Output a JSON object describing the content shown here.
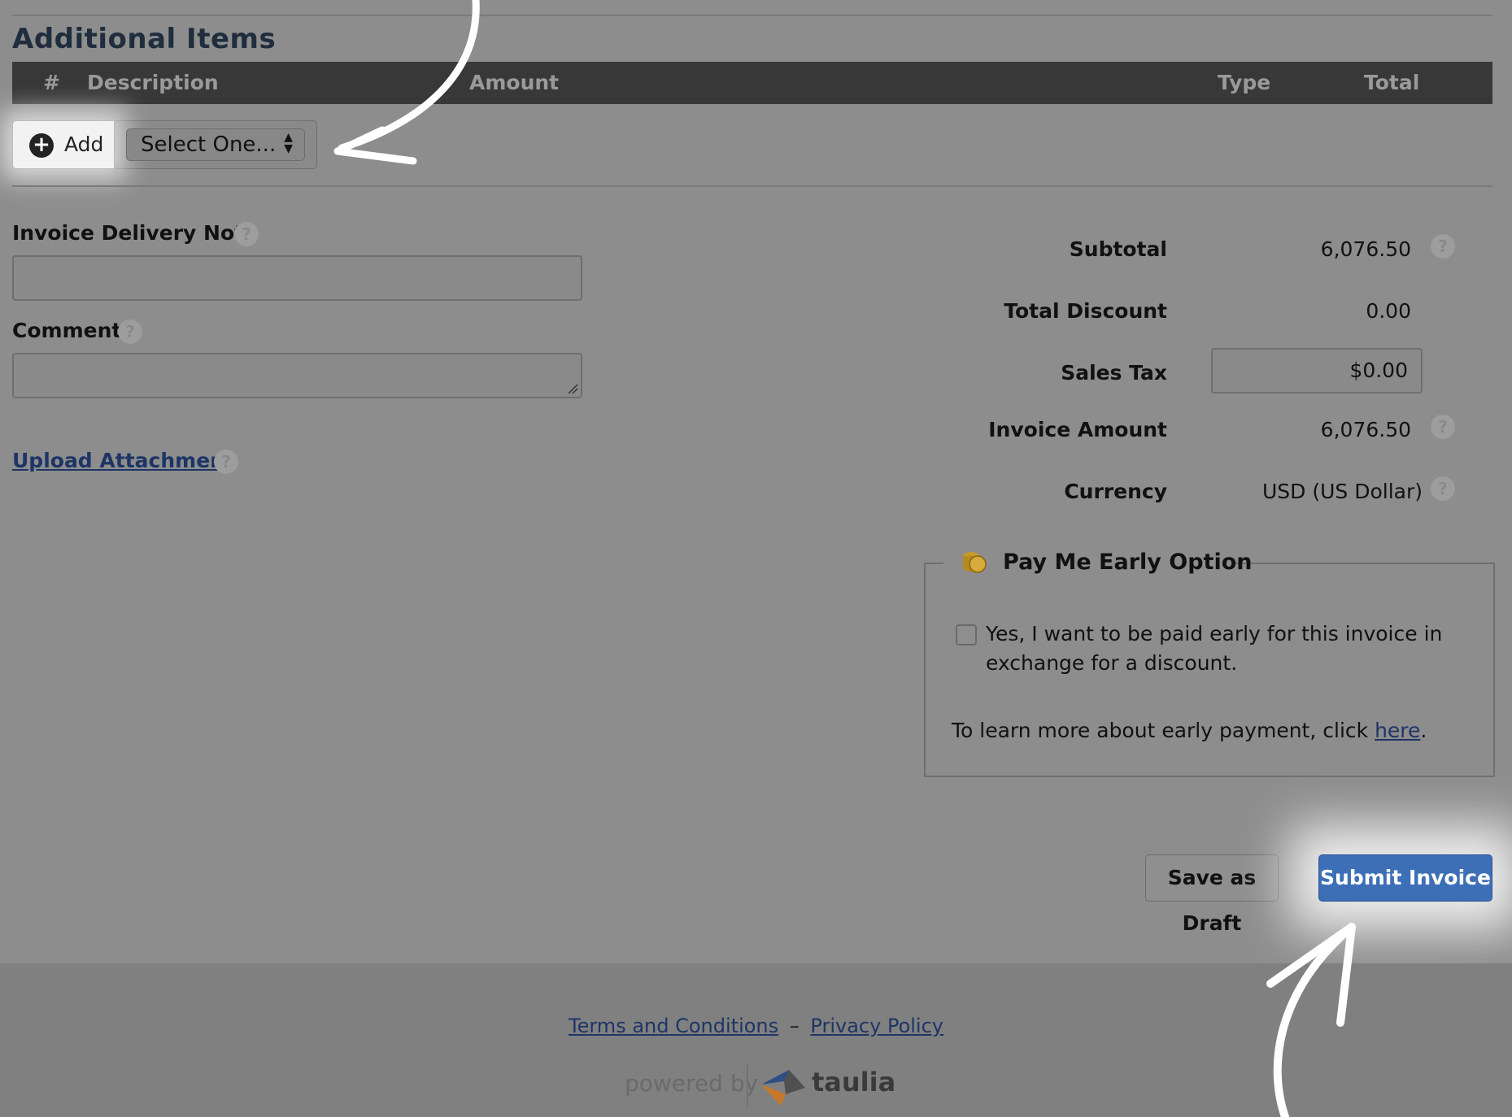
{
  "section": {
    "title": "Additional Items"
  },
  "table": {
    "columns": [
      "#",
      "Description",
      "Amount",
      "Type",
      "Total"
    ]
  },
  "add_bar": {
    "add_label": "Add",
    "select_value": "Select One..."
  },
  "form": {
    "delivery_note_label": "Invoice Delivery Note",
    "comment_label": "Comment",
    "upload_label": "Upload Attachment",
    "help_glyph": "?"
  },
  "summary": {
    "subtotal_label": "Subtotal",
    "subtotal_value": "6,076.50",
    "discount_label": "Total Discount",
    "discount_value": "0.00",
    "tax_label": "Sales Tax",
    "tax_value": "$0.00",
    "invoice_amount_label": "Invoice Amount",
    "invoice_amount_value": "6,076.50",
    "currency_label": "Currency",
    "currency_value": "USD (US Dollar)"
  },
  "pay_early": {
    "legend": "Pay Me Early Option",
    "checkbox_text": "Yes, I want to be paid early for this invoice in exchange for a discount.",
    "learn_prefix": "To learn more about early payment, click ",
    "learn_link": "here",
    "learn_suffix": "."
  },
  "actions": {
    "save_draft": "Save as Draft",
    "submit": "Submit Invoice"
  },
  "footer": {
    "terms": "Terms and Conditions",
    "separator": "–",
    "privacy": "Privacy Policy",
    "powered_by": "powered by",
    "brand": "taulia"
  },
  "icons": [
    "plus-circle-icon",
    "select-arrows-icon",
    "help-icon",
    "coin-icon",
    "taulia-logo-icon",
    "annotation-arrow-icon"
  ],
  "colors": {
    "primary_button": "#3d6fb6",
    "table_header": "#383838",
    "link": "#1d3566",
    "coin": "#c59a2a"
  }
}
